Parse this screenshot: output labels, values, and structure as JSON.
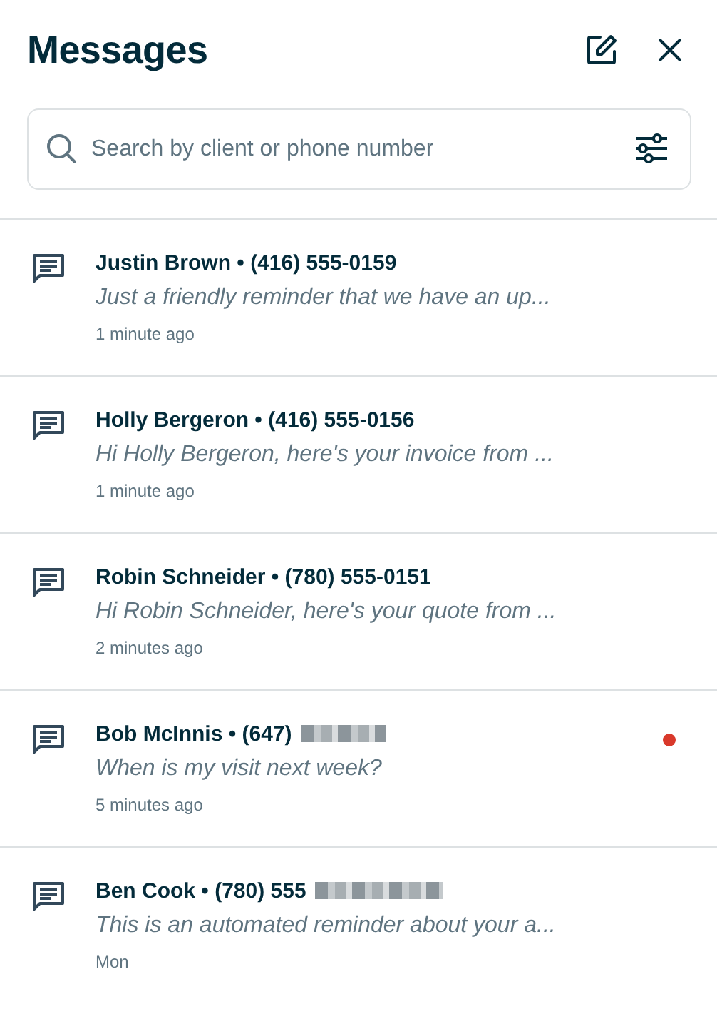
{
  "header": {
    "title": "Messages"
  },
  "search": {
    "placeholder": "Search by client or phone number"
  },
  "conversations": [
    {
      "contact": "Justin Brown • (416) 555-0159",
      "redacted": false,
      "preview": "Just a friendly reminder that we have an up...",
      "time": "1 minute ago",
      "unread": false
    },
    {
      "contact": "Holly Bergeron • (416) 555-0156",
      "redacted": false,
      "preview": "Hi Holly Bergeron, here's your invoice from ...",
      "time": "1 minute ago",
      "unread": false
    },
    {
      "contact": "Robin Schneider • (780) 555-0151",
      "redacted": false,
      "preview": "Hi Robin Schneider, here's your quote from ...",
      "time": "2 minutes ago",
      "unread": false
    },
    {
      "contact": "Bob McInnis • (647)",
      "redacted": true,
      "preview": "When is my visit next week?",
      "time": "5 minutes ago",
      "unread": true
    },
    {
      "contact": "Ben Cook • (780) 555",
      "redacted": true,
      "preview": "This is an automated reminder about your a...",
      "time": "Mon",
      "unread": false
    }
  ]
}
